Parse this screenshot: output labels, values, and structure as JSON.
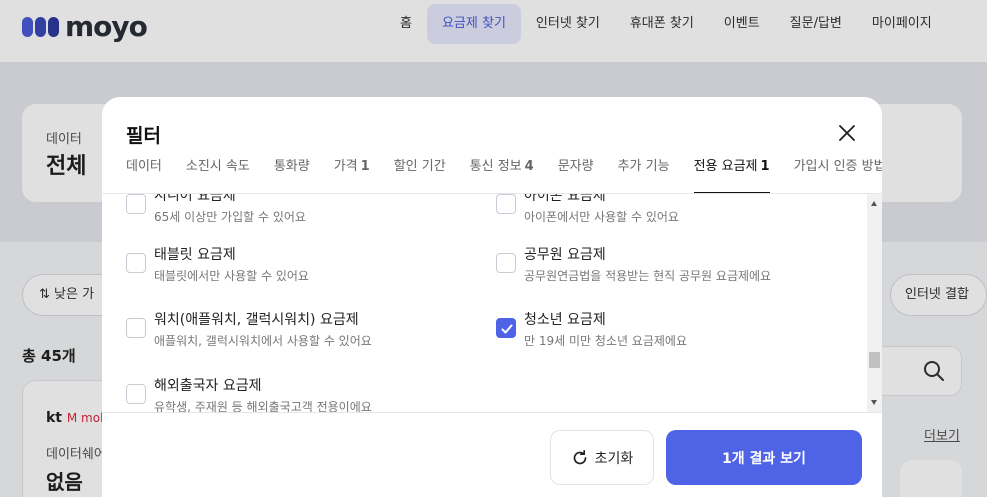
{
  "brand": {
    "name": "moyo",
    "accent": "#4f63e6"
  },
  "nav": {
    "items": [
      {
        "label": "홈",
        "active": false
      },
      {
        "label": "요금제 찾기",
        "active": true
      },
      {
        "label": "인터넷 찾기",
        "active": false
      },
      {
        "label": "휴대폰 찾기",
        "active": false
      },
      {
        "label": "이벤트",
        "active": false
      },
      {
        "label": "질문/답변",
        "active": false
      },
      {
        "label": "마이페이지",
        "active": false
      }
    ]
  },
  "background": {
    "data_label": "데이터",
    "data_value": "전체",
    "sort_label": "낮은 가",
    "internet_label": "인터넷 결합",
    "total": "총 45개",
    "carrier_kt": "kt",
    "carrier_mobile": "M mobile",
    "data_share_label": "데이터쉐어",
    "data_share_value": "없음",
    "more_link": "더보기"
  },
  "modal": {
    "title": "필터",
    "tabs": [
      {
        "label": "데이터",
        "count": "",
        "active": false
      },
      {
        "label": "소진시 속도",
        "count": "",
        "active": false
      },
      {
        "label": "통화량",
        "count": "",
        "active": false
      },
      {
        "label": "가격",
        "count": "1",
        "active": false
      },
      {
        "label": "할인 기간",
        "count": "",
        "active": false
      },
      {
        "label": "통신 정보",
        "count": "4",
        "active": false
      },
      {
        "label": "문자량",
        "count": "",
        "active": false
      },
      {
        "label": "추가 기능",
        "count": "",
        "active": false
      },
      {
        "label": "전용 요금제",
        "count": "1",
        "active": true
      },
      {
        "label": "가입시 인증 방법",
        "count": "",
        "active": false
      }
    ],
    "options": [
      {
        "title": "시니어 요금제",
        "desc": "65세 이상만 가입할 수 있어요",
        "checked": false
      },
      {
        "title": "아이폰 요금제",
        "desc": "아이폰에서만 사용할 수 있어요",
        "checked": false
      },
      {
        "title": "태블릿 요금제",
        "desc": "태블릿에서만 사용할 수 있어요",
        "checked": false
      },
      {
        "title": "공무원 요금제",
        "desc": "공무원연금법을 적용받는 현직 공무원 요금제에요",
        "checked": false
      },
      {
        "title": "워치(애플워치, 갤럭시워치) 요금제",
        "desc": "애플워치, 갤럭시워치에서 사용할 수 있어요",
        "checked": false
      },
      {
        "title": "청소년 요금제",
        "desc": "만 19세 미만 청소년 요금제에요",
        "checked": true
      },
      {
        "title": "해외출국자 요금제",
        "desc": "유학생, 주재원 등 해외출국고객 전용이에요",
        "checked": false
      }
    ],
    "reset_label": "초기화",
    "apply_label": "1개 결과 보기"
  }
}
